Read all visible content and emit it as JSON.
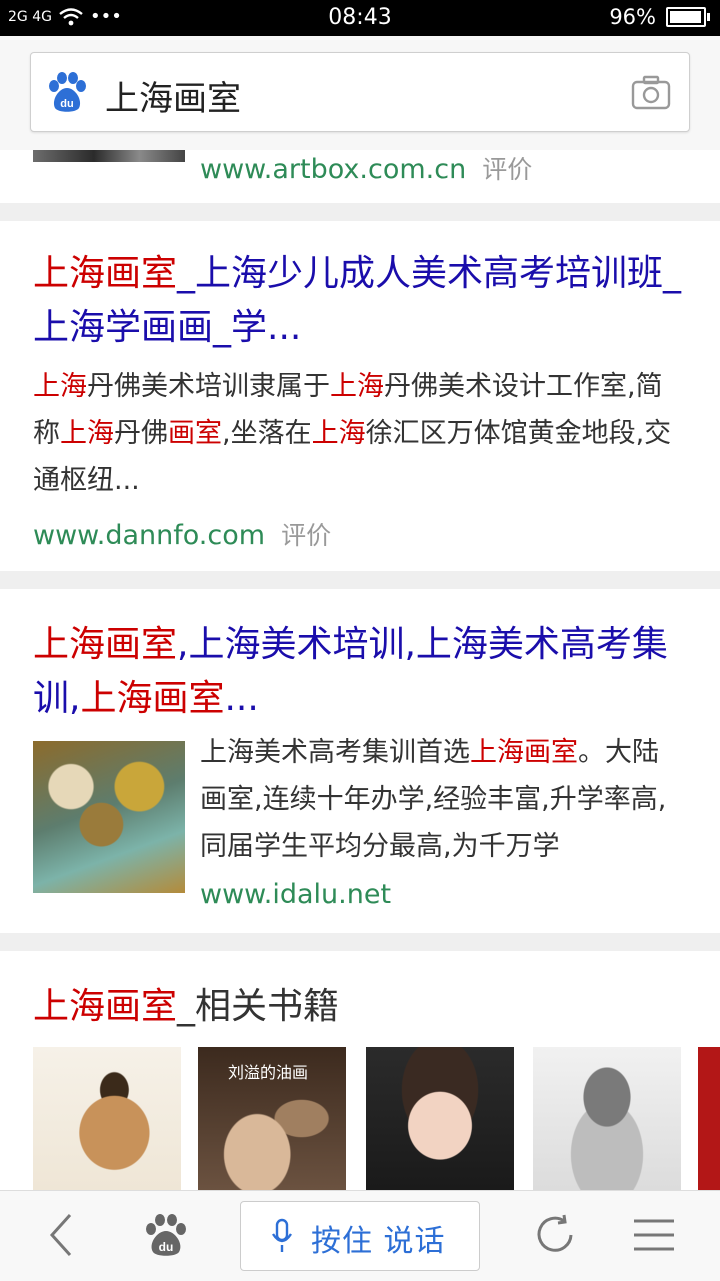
{
  "status": {
    "signal": "2G 4G",
    "dots": "•••",
    "time": "08:43",
    "battery": "96%",
    "battery_level": 0.96
  },
  "search": {
    "query": "上海画室"
  },
  "results": [
    {
      "url": "www.artbox.com.cn",
      "rate": "评价"
    },
    {
      "title_parts": [
        {
          "text": "上海画室",
          "hl": true
        },
        {
          "text": "_上海少儿成人美术高考培训班_上海学画画_学...",
          "hl": false
        }
      ],
      "desc_parts": [
        {
          "text": "上海",
          "hl": true
        },
        {
          "text": "丹佛美术培训隶属于",
          "hl": false
        },
        {
          "text": "上海",
          "hl": true
        },
        {
          "text": "丹佛美术设计工作室,简称",
          "hl": false
        },
        {
          "text": "上海",
          "hl": true
        },
        {
          "text": "丹佛",
          "hl": false
        },
        {
          "text": "画室",
          "hl": true
        },
        {
          "text": ",坐落在",
          "hl": false
        },
        {
          "text": "上海",
          "hl": true
        },
        {
          "text": "徐汇区万体馆黄金地段,交通枢纽...",
          "hl": false
        }
      ],
      "url": "www.dannfo.com",
      "rate": "评价"
    },
    {
      "title_parts": [
        {
          "text": "上海画室",
          "hl": true
        },
        {
          "text": ",上海美术培训,上海美术高考集训,",
          "hl": false
        },
        {
          "text": "上海画室",
          "hl": true
        },
        {
          "text": "...",
          "hl": false
        }
      ],
      "desc_parts": [
        {
          "text": "上海美术高考集训首选",
          "hl": false
        },
        {
          "text": "上海画室",
          "hl": true
        },
        {
          "text": "。大陆画室,连续十年办学,经验丰富,升学率高,同届学生平均分最高,为千万学",
          "hl": false
        }
      ],
      "url": "www.idalu.net"
    }
  ],
  "books": {
    "title_hl": "上海画室",
    "title_rest": "_相关书籍",
    "items": [
      {
        "cover_text": ""
      },
      {
        "cover_text": "刘溢的油画"
      },
      {
        "cover_text": ""
      },
      {
        "cover_text": ""
      }
    ]
  },
  "bottom_nav": {
    "voice_label": "按住 说话"
  }
}
